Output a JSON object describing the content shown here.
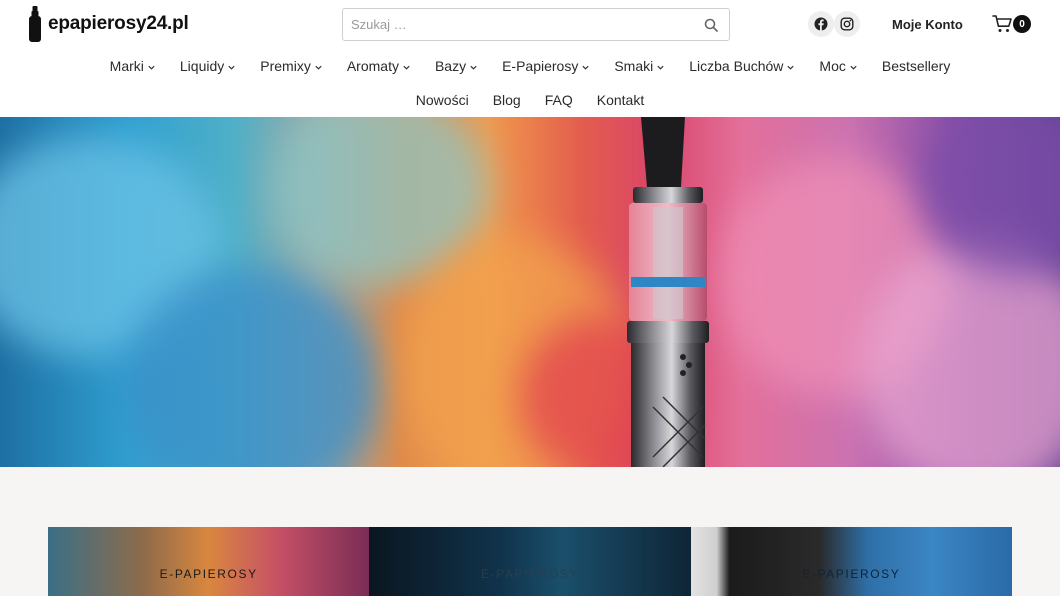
{
  "header": {
    "logo_text": "epapierosy24.pl",
    "search": {
      "placeholder": "Szukaj …"
    },
    "account_label": "Moje Konto",
    "cart_count": "0"
  },
  "nav": {
    "row1": [
      {
        "label": "Marki",
        "dropdown": true
      },
      {
        "label": "Liquidy",
        "dropdown": true
      },
      {
        "label": "Premixy",
        "dropdown": true
      },
      {
        "label": "Aromaty",
        "dropdown": true
      },
      {
        "label": "Bazy",
        "dropdown": true
      },
      {
        "label": "E-Papierosy",
        "dropdown": true
      },
      {
        "label": "Smaki",
        "dropdown": true
      },
      {
        "label": "Liczba Buchów",
        "dropdown": true
      },
      {
        "label": "Moc",
        "dropdown": true
      },
      {
        "label": "Bestsellery",
        "dropdown": false
      }
    ],
    "row2": [
      {
        "label": "Nowości"
      },
      {
        "label": "Blog"
      },
      {
        "label": "FAQ"
      },
      {
        "label": "Kontakt"
      }
    ]
  },
  "categories": [
    {
      "label": "E-PAPIEROSY"
    },
    {
      "label": "E-PAPIEROSY"
    },
    {
      "label": "E-PAPIEROSY"
    }
  ],
  "icons": {
    "search": "search-icon",
    "facebook": "facebook-icon",
    "instagram": "instagram-icon",
    "cart": "cart-icon",
    "logo": "vape-bottle-icon"
  },
  "colors": {
    "text": "#1f1f1f",
    "badge": "#111111",
    "section_bg": "#f7f5f3"
  }
}
